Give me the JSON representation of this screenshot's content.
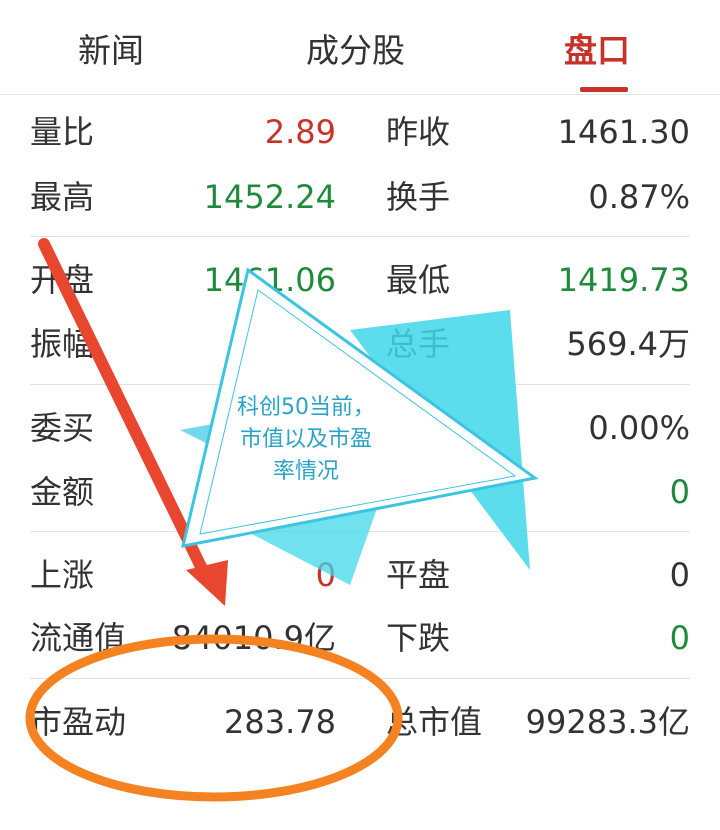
{
  "tabs": [
    {
      "label": "新闻"
    },
    {
      "label": "成分股"
    },
    {
      "label": "盘口"
    }
  ],
  "stats": {
    "liangbi": {
      "label": "量比",
      "value": "2.89"
    },
    "zuoshou": {
      "label": "昨收",
      "value": "1461.30"
    },
    "zuigao": {
      "label": "最高",
      "value": "1452.24"
    },
    "huanshou": {
      "label": "换手",
      "value": "0.87%"
    },
    "kaipan": {
      "label": "开盘",
      "value": "1461.06"
    },
    "zuidi": {
      "label": "最低",
      "value": "1419.73"
    },
    "zhenfu": {
      "label": "振幅"
    },
    "zongshou": {
      "label": "总手",
      "value": "569.4万"
    },
    "weimai": {
      "label": "委买"
    },
    "weibi": {
      "value": "0.00%"
    },
    "jine": {
      "label": "金额"
    },
    "weicha": {
      "value": "0"
    },
    "shangzhang": {
      "label": "上涨",
      "value": "0"
    },
    "pingpan": {
      "label": "平盘",
      "value": "0"
    },
    "liutongzhi": {
      "label": "流通值",
      "value": "84010.9亿"
    },
    "xiadie": {
      "label": "下跌",
      "value": "0"
    },
    "shiyingdong": {
      "label": "市盈动",
      "value": "283.78"
    },
    "zongshizhi": {
      "label": "总市值",
      "value": "99283.3亿"
    }
  },
  "annotation": {
    "callout_text_lines": [
      "科创50当前，",
      "市值以及市盈",
      "率情况"
    ],
    "arrow_color": "#e8462f",
    "ellipse_color": "#f58220",
    "triangle_color": "#3fd7ea"
  },
  "colors": {
    "accent_red": "#c8322b",
    "up_green": "#1f8a3b"
  }
}
